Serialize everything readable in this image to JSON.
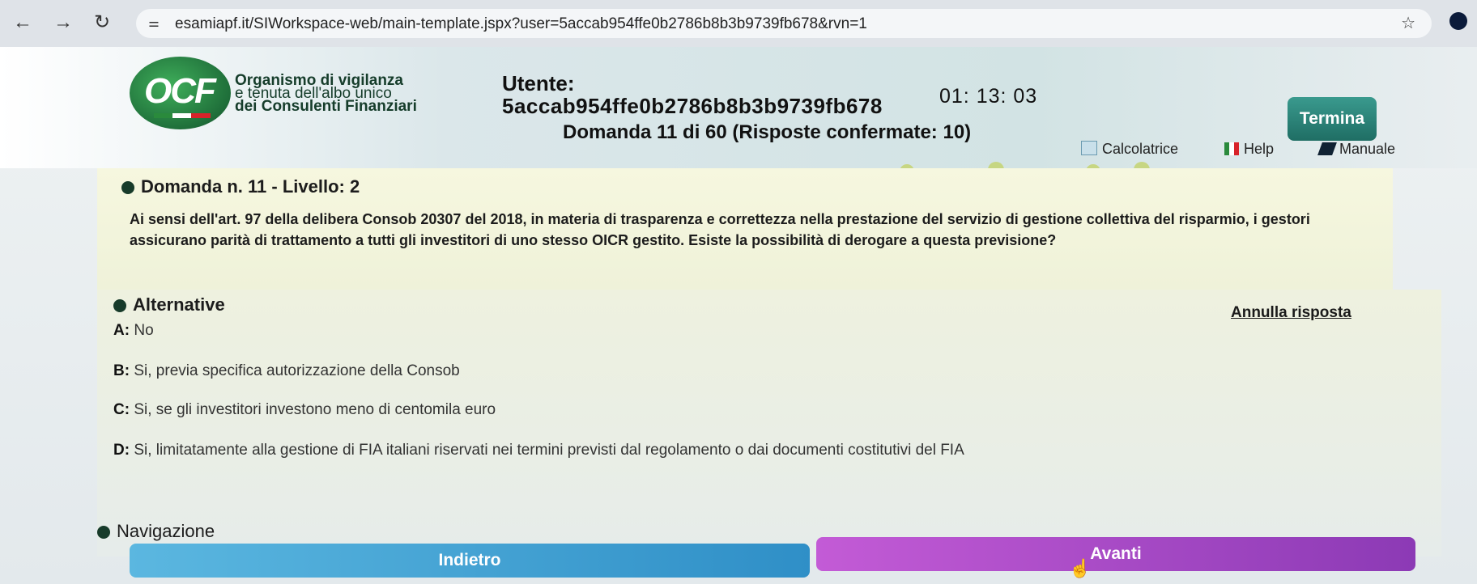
{
  "browser": {
    "url": "esamiapf.it/SIWorkspace-web/main-template.jspx?user=5accab954ffe0b2786b8b3b9739fb678&rvn=1"
  },
  "header": {
    "logo_text": "OCF",
    "org_line1": "Organismo di vigilanza",
    "org_line2": "e tenuta dell'albo unico",
    "org_line3": "dei Consulenti Finanziari",
    "user_label": "Utente:",
    "user_value": "5accab954ffe0b2786b8b3b9739fb678",
    "timer": "01: 13: 03",
    "termina_label": "Termina",
    "question_counter": "Domanda 11 di 60 (Risposte confermate: 10)",
    "tools": {
      "calculator": "Calcolatrice",
      "help": "Help",
      "manual": "Manuale"
    }
  },
  "question": {
    "heading": "Domanda n. 11 - Livello: 2",
    "text": "Ai sensi dell'art. 97 della delibera Consob 20307 del 2018, in materia di trasparenza e correttezza nella prestazione del servizio di gestione collettiva del risparmio, i gestori assicurano parità di trattamento a tutti gli investitori di uno stesso OICR gestito. Esiste la possibilità di derogare a questa previsione?"
  },
  "alternatives": {
    "heading": "Alternative",
    "cancel_label": "Annulla risposta",
    "items": [
      {
        "key": "A:",
        "text": "No"
      },
      {
        "key": "B:",
        "text": "Si, previa specifica autorizzazione della Consob"
      },
      {
        "key": "C:",
        "text": "Si, se gli investitori investono meno di centomila euro"
      },
      {
        "key": "D:",
        "text": "Si, limitatamente alla gestione di FIA italiani riservati nei termini previsti dal regolamento o dai documenti costitutivi del FIA"
      }
    ]
  },
  "navigation": {
    "heading": "Navigazione",
    "back_label": "Indietro",
    "next_label": "Avanti"
  }
}
